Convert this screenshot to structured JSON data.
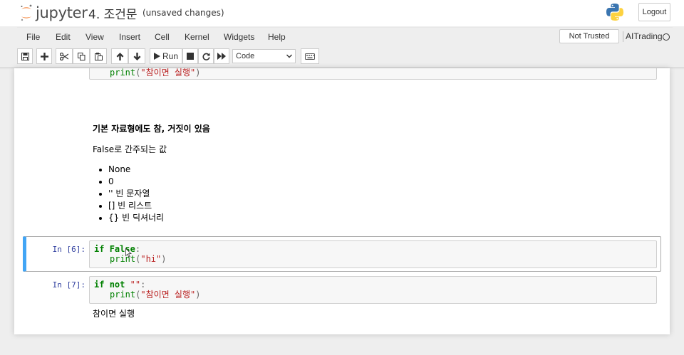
{
  "header": {
    "logo_text": "jupyter",
    "notebook_name": "4. 조건문",
    "save_status": "(unsaved changes)",
    "logout_label": "Logout"
  },
  "menubar": {
    "items": [
      "File",
      "Edit",
      "View",
      "Insert",
      "Cell",
      "Kernel",
      "Widgets",
      "Help"
    ],
    "trust_label": "Not Trusted",
    "kernel_name": "AITrading"
  },
  "toolbar": {
    "run_label": "Run",
    "cell_type": "Code",
    "icons": [
      "save-icon",
      "plus-icon",
      "cut-icon",
      "copy-icon",
      "paste-icon",
      "arrow-up-icon",
      "arrow-down-icon",
      "play-icon",
      "stop-icon",
      "restart-icon",
      "fast-forward-icon",
      "keyboard-icon"
    ]
  },
  "cells": {
    "prev_code": {
      "line1_func": "print",
      "line1_str": "\"참이면 실행\""
    },
    "markdown": {
      "heading": "기본 자료형에도 참, 거짓이 있음",
      "para": "False로 간주되는 값",
      "list": [
        "None",
        "0",
        "'' 빈 문자열",
        "[] 빈 리스트",
        "{} 빈 딕셔너리"
      ]
    },
    "cell6": {
      "prompt": "In [6]:",
      "kw_if": "if",
      "val": "False",
      "colon": ":",
      "func": "print",
      "str": "\"hi\""
    },
    "cell7": {
      "prompt": "In [7]:",
      "kw_if": "if",
      "kw_not": "not",
      "str_empty": "\"\"",
      "colon": ":",
      "func": "print",
      "str": "\"참이면 실행\"",
      "output": "참이면 실행"
    }
  },
  "colors": {
    "accent_selected": "#42a5f5",
    "prompt": "#303f9f",
    "keyword": "#008000",
    "string": "#ba2121"
  }
}
